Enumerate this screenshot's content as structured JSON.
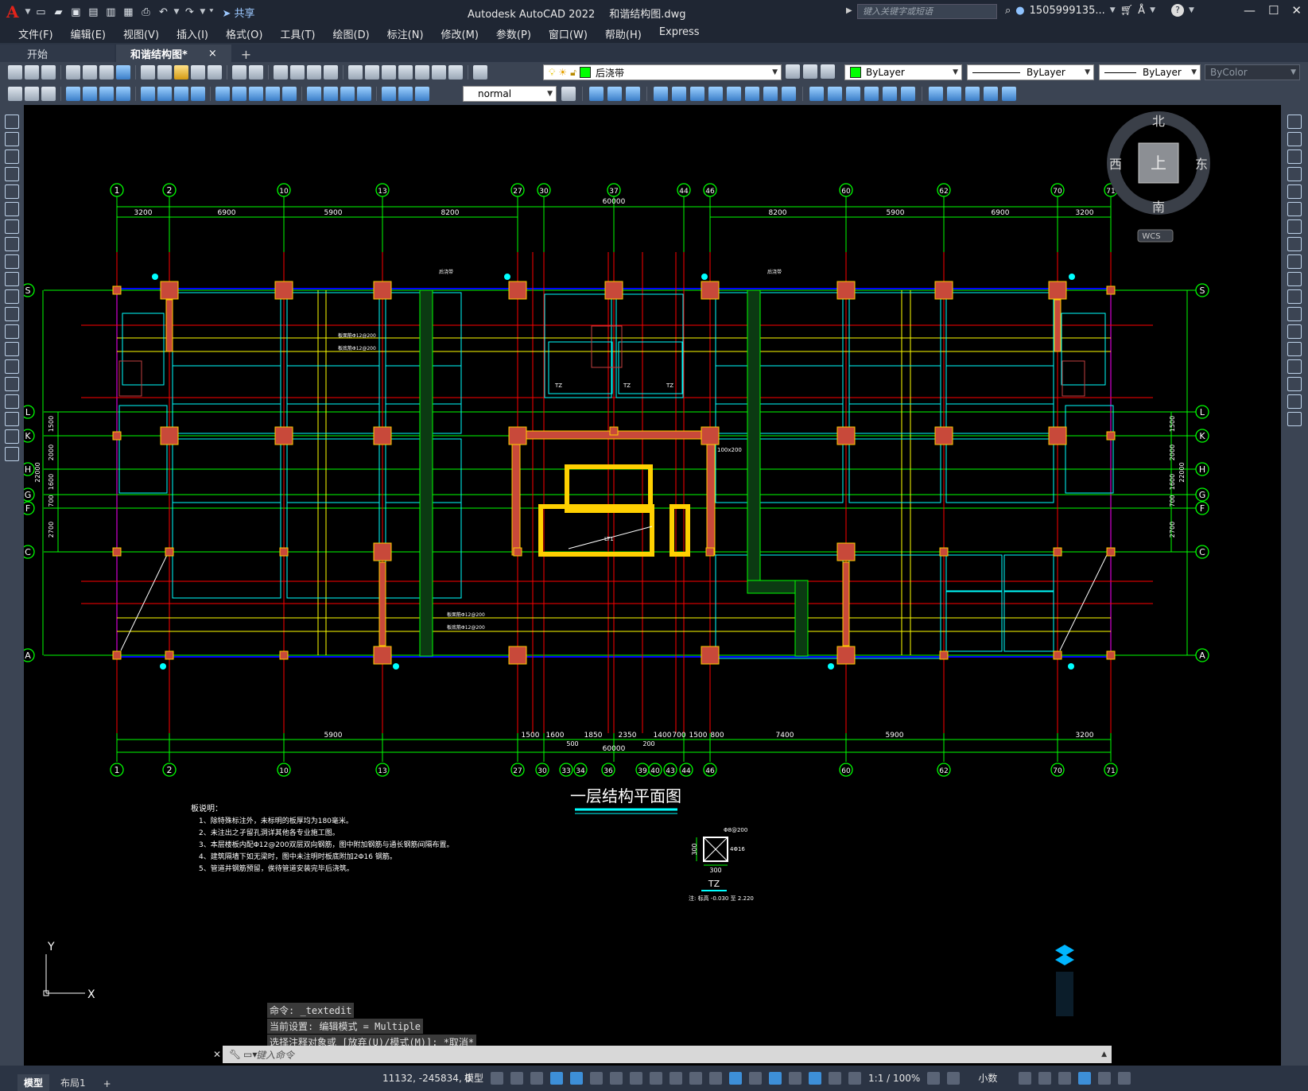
{
  "app": {
    "logo": "A",
    "title": "Autodesk AutoCAD 2022",
    "file": "和谐结构图.dwg",
    "share_label": "共享",
    "search_placeholder": "键入关键字或短语",
    "user": "1505999135...",
    "help": "?"
  },
  "menu": [
    "文件(F)",
    "编辑(E)",
    "视图(V)",
    "插入(I)",
    "格式(O)",
    "工具(T)",
    "绘图(D)",
    "标注(N)",
    "修改(M)",
    "参数(P)",
    "窗口(W)",
    "帮助(H)",
    "Express"
  ],
  "tabs": {
    "start": "开始",
    "drawing": "和谐结构图*",
    "close": "×",
    "add": "+"
  },
  "toolbar": {
    "layer": "后浇带",
    "color": "ByLayer",
    "linetype": "ByLayer",
    "lineweight": "ByLayer",
    "plotstyle": "ByColor",
    "textstyle": "normal"
  },
  "colors": {
    "layer_swatch": "#00ff00",
    "color_swatch": "#00ff00",
    "axis": "#00ff00",
    "wall": "#00ffff",
    "beam": "#ff0000",
    "column_fill": "#c8493a",
    "column_edge": "#ffd000",
    "slab": "#0000ff",
    "dim": "#00ff00",
    "highlight": "#ff00ff"
  },
  "drawing": {
    "top_axes": [
      "1",
      "2",
      "10",
      "13",
      "27",
      "30",
      "37",
      "44",
      "46",
      "60",
      "62",
      "70",
      "71"
    ],
    "bottom_axes": [
      "1",
      "2",
      "10",
      "13",
      "27",
      "30",
      "33",
      "34",
      "36",
      "39",
      "40",
      "43",
      "44",
      "46",
      "60",
      "62",
      "70",
      "71"
    ],
    "side_axes": [
      "S",
      "L",
      "K",
      "H",
      "G",
      "F",
      "C",
      "A"
    ],
    "top_dims_left": [
      "3200",
      "6900",
      "5900",
      "8200"
    ],
    "top_dims_right": [
      "8200",
      "5900",
      "6900",
      "3200"
    ],
    "top_total": "60000",
    "bottom_dims": [
      "5900",
      "1500",
      "1600",
      "1850",
      "2350",
      "1400",
      "700",
      "1500",
      "800",
      "7400",
      "5900",
      "3200"
    ],
    "bottom_small": [
      "500",
      "200"
    ],
    "bottom_total": "60000",
    "side_dims": [
      "1500",
      "2000",
      "1600",
      "700",
      "2700"
    ],
    "side_total": "22000",
    "title": "一层结构平面图",
    "notes_heading": "板说明：",
    "notes": [
      "1、除特殊标注外，未标明的板厚均为180毫米。",
      "2、未注出之孑留孔洞详其他各专业施工图。",
      "3、本层楼板内配Φ12@200双层双向钢筋，图中附加钢筋与通长钢筋间隔布置。",
      "4、建筑隔墙下如无梁时，图中未注明时板底附加2Φ16 钢筋。",
      "5、管道井钢筋预留，俟待管道安装完毕后浇筑。"
    ],
    "tz_label": "TZ",
    "tz_dim_w": "300",
    "tz_dim_h": "300",
    "tz_note": "注: 标高 -0.030 至 2.220",
    "tz_top_note": "Φ8@200",
    "tz_side_note": "4Φ16",
    "rebar_notes": [
      "板面筋Φ12@200",
      "板底筋Φ12@200"
    ],
    "tag_tz": "TZ",
    "tag_lt": "LT1",
    "hzd": "后浇带",
    "side_box_label": "100x200"
  },
  "navcube": {
    "north": "北",
    "south": "南",
    "east": "东",
    "west": "西",
    "face": "上",
    "wcs": "WCS"
  },
  "ucs": {
    "x": "X",
    "y": "Y"
  },
  "command": {
    "lines": [
      "命令: _textedit",
      "当前设置: 编辑模式 = Multiple",
      "选择注释对象或 [放弃(U)/模式(M)]: *取消*"
    ],
    "placeholder": "键入命令"
  },
  "status": {
    "tabs": [
      "模型",
      "布局1"
    ],
    "add": "+",
    "coords": "11132, -245834, 0",
    "space": "模型",
    "scale": "1:1 / 100%",
    "units": "小数"
  }
}
